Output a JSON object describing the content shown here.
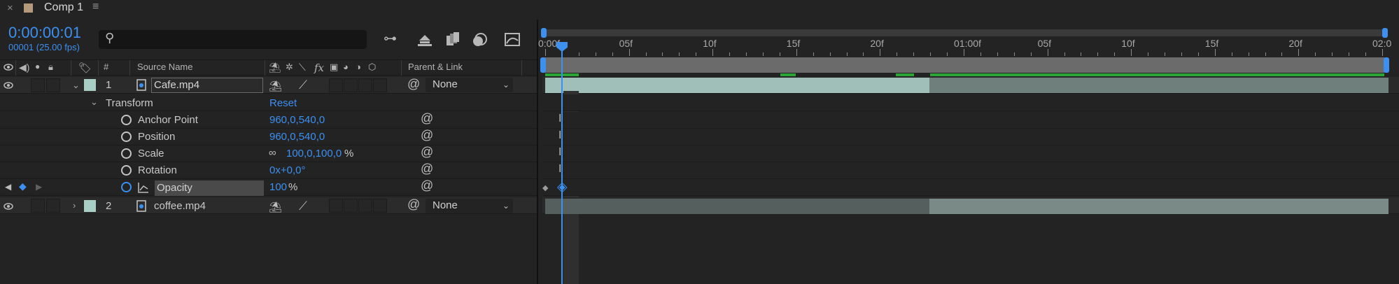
{
  "tab": {
    "close_glyph": "×",
    "title": "Comp 1",
    "menu_glyph": "≡"
  },
  "header": {
    "timecode": "0:00:00:01",
    "fps": "00001 (25.00 fps)",
    "search_placeholder": ""
  },
  "columns": {
    "hash": "#",
    "source_name": "Source Name",
    "parent_link": "Parent & Link",
    "switch_fx": "fx"
  },
  "layers": [
    {
      "number": "1",
      "name": "Cafe.mp4",
      "parent": "None",
      "expanded": true
    },
    {
      "number": "2",
      "name": "coffee.mp4",
      "parent": "None",
      "expanded": false
    }
  ],
  "transform": {
    "label": "Transform",
    "reset": "Reset",
    "properties": [
      {
        "name": "Anchor Point",
        "value": "960,0,540,0",
        "suffix": ""
      },
      {
        "name": "Position",
        "value": "960,0,540,0",
        "suffix": ""
      },
      {
        "name": "Scale",
        "value": "100,0,100,0",
        "suffix": "%"
      },
      {
        "name": "Rotation",
        "value": "0x+0,0°",
        "suffix": ""
      },
      {
        "name": "Opacity",
        "value": "100",
        "suffix": "%"
      }
    ]
  },
  "ruler": {
    "labels": [
      "0:00f",
      "05f",
      "10f",
      "15f",
      "20f",
      "01:00f",
      "05f",
      "10f",
      "15f",
      "20f",
      "02:0"
    ]
  },
  "colors": {
    "accent": "#3d8ff0",
    "clip": "#9fbfb8",
    "clip_dim": "#6f807c",
    "cache": "#2ba636"
  },
  "playhead_frame": 1
}
